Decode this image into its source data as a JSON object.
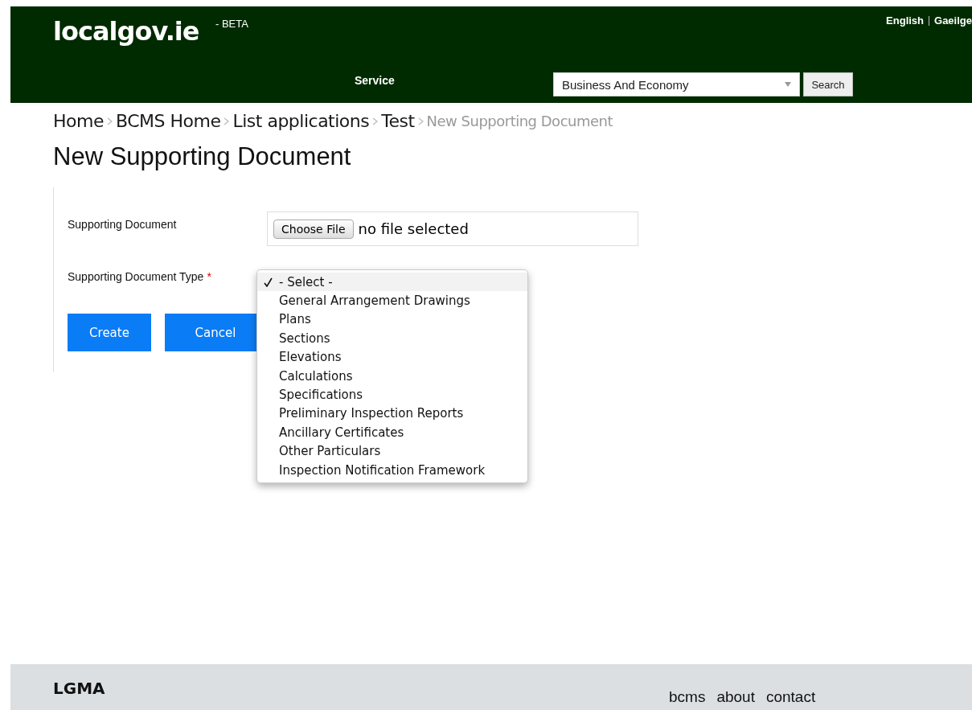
{
  "header": {
    "logo": "localgov.ie",
    "badge": "- BETA",
    "languages": [
      "English",
      "Gaeilge"
    ],
    "service_label": "Service",
    "service_select": {
      "value": "Business And Economy"
    },
    "search_button": "Search"
  },
  "breadcrumb": {
    "links": [
      "Home",
      "BCMS Home",
      "List applications",
      "Test"
    ],
    "current": "New Supporting Document"
  },
  "heading": "New Supporting Document",
  "form": {
    "file_field": {
      "label": "Supporting Document",
      "button": "Choose File",
      "status": "no file selected"
    },
    "type_field": {
      "label": "Supporting Document Type",
      "required_mark": "*",
      "expanded": true,
      "options": [
        {
          "label": "- Select -",
          "selected": true
        },
        {
          "label": "General Arrangement Drawings",
          "selected": false
        },
        {
          "label": "Plans",
          "selected": false
        },
        {
          "label": "Sections",
          "selected": false
        },
        {
          "label": "Elevations",
          "selected": false
        },
        {
          "label": "Calculations",
          "selected": false
        },
        {
          "label": "Specifications",
          "selected": false
        },
        {
          "label": "Preliminary Inspection Reports",
          "selected": false
        },
        {
          "label": "Ancillary Certificates",
          "selected": false
        },
        {
          "label": "Other Particulars",
          "selected": false
        },
        {
          "label": "Inspection Notification Framework",
          "selected": false
        }
      ]
    },
    "buttons": [
      "Create",
      "Cancel"
    ]
  },
  "footer": {
    "brand": "LGMA",
    "links": [
      "bcms",
      "about",
      "contact"
    ]
  }
}
